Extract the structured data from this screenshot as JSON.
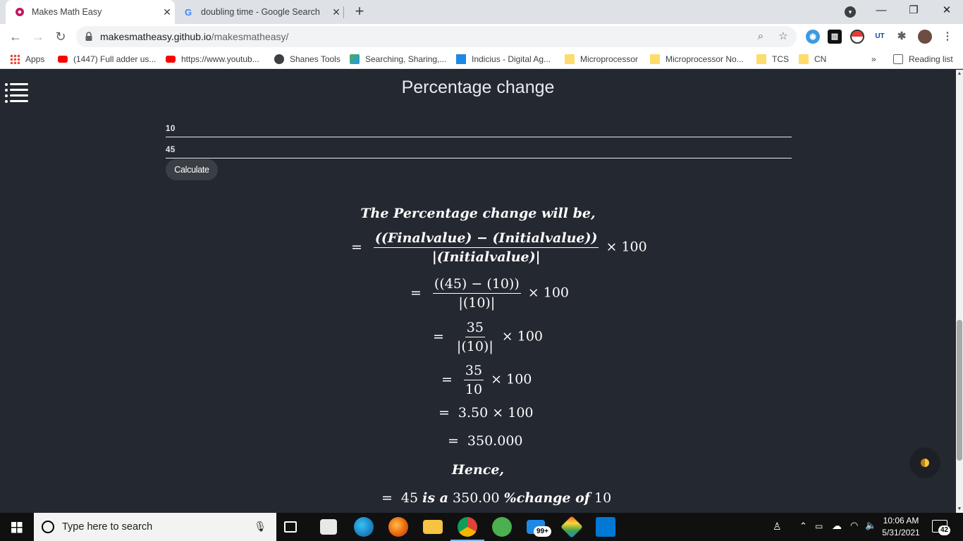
{
  "browser": {
    "tabs": [
      {
        "title": "Makes Math Easy",
        "active": true
      },
      {
        "title": "doubling time - Google Search",
        "active": false
      }
    ],
    "url_domain": "makesmatheasy.github.io",
    "url_path": "/makesmatheasy/",
    "bookmarks": [
      {
        "label": "Apps",
        "icon": "apps-grid-icon"
      },
      {
        "label": "(1447) Full adder us...",
        "icon": "youtube-icon"
      },
      {
        "label": "https://www.youtub...",
        "icon": "youtube-icon"
      },
      {
        "label": "Shanes Tools",
        "icon": "globe-icon"
      },
      {
        "label": "Searching, Sharing,...",
        "icon": "site-icon"
      },
      {
        "label": "Indicius - Digital Ag...",
        "icon": "indicius-icon"
      },
      {
        "label": "Microprocessor",
        "icon": "folder-icon"
      },
      {
        "label": "Microprocessor No...",
        "icon": "folder-icon"
      },
      {
        "label": "TCS",
        "icon": "folder-icon"
      },
      {
        "label": "CN",
        "icon": "folder-icon"
      }
    ],
    "overflow": "»",
    "reading_list": "Reading list"
  },
  "page": {
    "title": "Percentage change",
    "initial_value": "10",
    "final_value": "45",
    "calculate_label": "Calculate"
  },
  "solution": {
    "intro": "The Percentage change will be,",
    "step1_num": "((Finalvalue) − (Initialvalue))",
    "step1_den": "|(Initialvalue)|",
    "step2_num": "((45) − (10))",
    "step2_den": "|(10)|",
    "step3_num": "35",
    "step3_den": "|(10)|",
    "step4_num": "35",
    "step4_den": "10",
    "times100": "× 100",
    "step5": "3.50 × 100",
    "step6": "350.000",
    "hence": "Hence,",
    "result_prefix": "45",
    "result_is_a": "is a",
    "result_value": "350.00",
    "result_suffix": "%change of",
    "result_initial": "10",
    "equals": "="
  },
  "taskbar": {
    "search_placeholder": "Type here to search",
    "mail_badge": "99+",
    "time": "10:06 AM",
    "date": "5/31/2021",
    "notifications": "42"
  },
  "colors": {
    "page_bg": "#242830",
    "accent": "#f6c343"
  }
}
